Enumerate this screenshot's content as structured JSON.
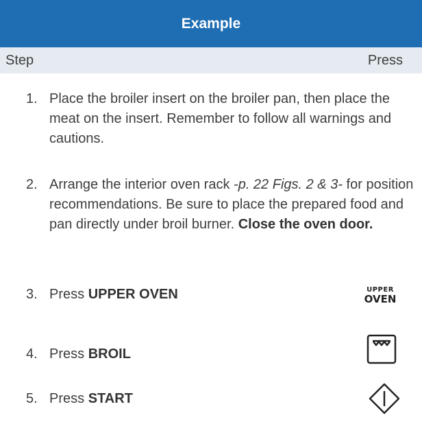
{
  "header": {
    "title": "Example"
  },
  "columns": {
    "step": "Step",
    "press": "Press"
  },
  "steps": [
    {
      "num": "1.",
      "segments": [
        {
          "text": "Place the broiler insert on the broiler pan, then place the meat on the insert. Remember to follow all warnings and cautions."
        }
      ]
    },
    {
      "num": "2.",
      "segments": [
        {
          "text": "Arrange the interior oven rack "
        },
        {
          "text": "-p. 22 Figs. 2 & 3-",
          "style": "italic"
        },
        {
          "text": " for position recommendations. Be sure to place the prepared food and pan directly under broil burner. "
        },
        {
          "text": "Close the oven door.",
          "style": "bold"
        }
      ]
    },
    {
      "num": "3.",
      "segments": [
        {
          "text": "Press "
        },
        {
          "text": "UPPER OVEN",
          "style": "bold"
        }
      ],
      "button": {
        "label_line1": "UPPER",
        "label_line2": "OVEN"
      }
    },
    {
      "num": "4.",
      "segments": [
        {
          "text": "Press "
        },
        {
          "text": "BROIL",
          "style": "bold"
        }
      ],
      "button": {
        "icon": "broil-icon"
      }
    },
    {
      "num": "5.",
      "segments": [
        {
          "text": "Press "
        },
        {
          "text": "START",
          "style": "bold"
        }
      ],
      "button": {
        "icon": "start-icon"
      }
    }
  ],
  "colors": {
    "header_bg": "#1f6db3",
    "subheader_bg": "#e6ebf1",
    "text": "#3d3d3d"
  }
}
